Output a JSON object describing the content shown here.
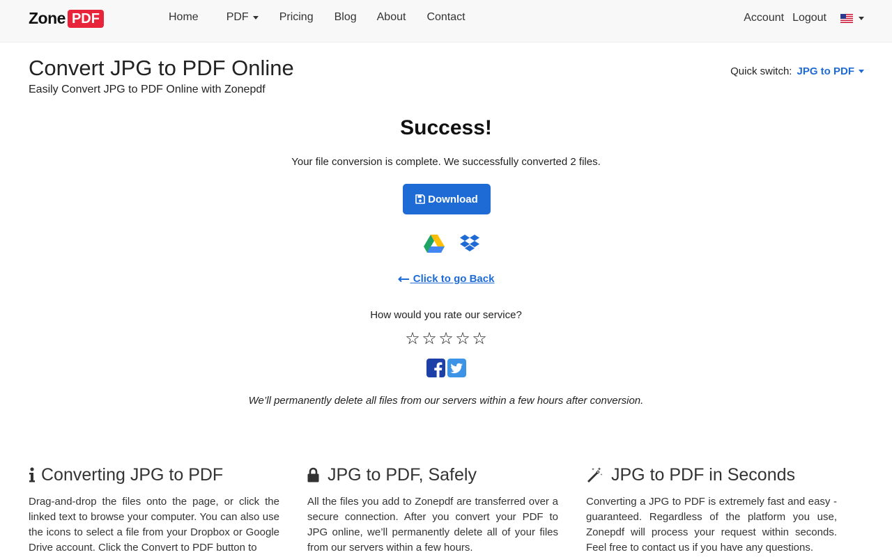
{
  "brand": {
    "zone": "Zone",
    "pdf": "PDF",
    "color": "#e8243b"
  },
  "nav": {
    "items": [
      {
        "label": "Home"
      },
      {
        "label": "PDF",
        "dropdown": true
      },
      {
        "label": "Pricing"
      },
      {
        "label": "Blog"
      },
      {
        "label": "About"
      },
      {
        "label": "Contact"
      }
    ],
    "account": "Account",
    "logout": "Logout",
    "language_icon": "us-flag-icon"
  },
  "header": {
    "title": "Convert JPG to PDF Online",
    "subtitle": "Easily Convert JPG to PDF Online with Zonepdf",
    "quick_switch_label": "Quick switch:",
    "quick_switch_value": "JPG to PDF"
  },
  "result": {
    "title": "Success!",
    "message": "Your file conversion is complete. We successfully converted 2 files.",
    "download_label": "Download",
    "back_label": "Click to go Back",
    "rate_question": "How would you rate our service?",
    "delete_note": "We’ll permanently delete all files from our servers within a few hours after conversion.",
    "star_glyph": "☆"
  },
  "features": [
    {
      "icon": "info-icon",
      "title": "Converting JPG to PDF",
      "text": "Drag-and-drop the files onto the page, or click the linked text to browse your computer. You can also use the icons to select a file from your Dropbox or Google Drive account. Click the Convert to PDF button to"
    },
    {
      "icon": "lock-icon",
      "title": "JPG to PDF, Safely",
      "text": "All the files you add to Zonepdf are transferred over a secure connection. After you convert your PDF to JPG online, we’ll permanently delete all of your files from our servers within a few hours."
    },
    {
      "icon": "magic-wand-icon",
      "title": "JPG to PDF in Seconds",
      "text": "Converting a JPG to PDF is extremely fast and easy - guaranteed. Regardless of the platform you use, Zonepdf will process your request within seconds. Feel free to contact us if you have any questions."
    }
  ],
  "colors": {
    "accent": "#1f6bd6",
    "facebook": "#1d3fa8",
    "twitter": "#3d94e6"
  }
}
